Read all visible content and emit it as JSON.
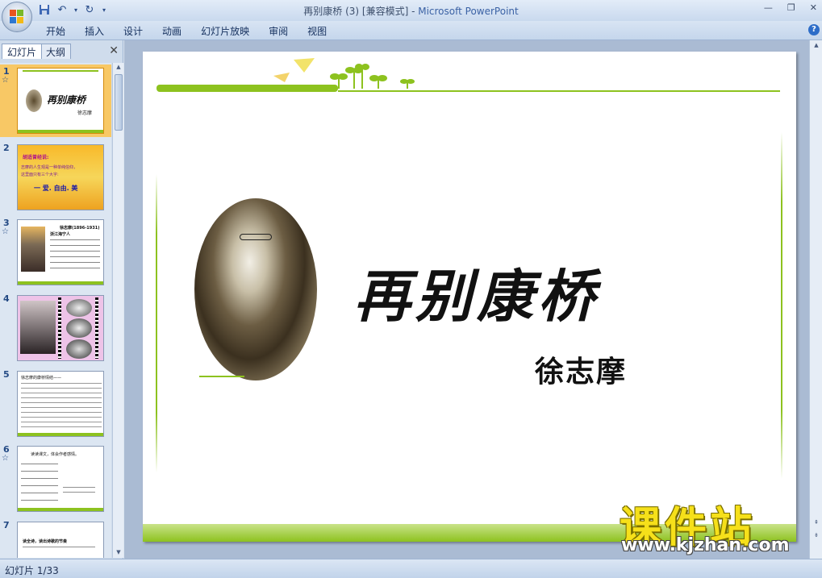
{
  "window": {
    "title_doc": "再别康桥 (3) [兼容模式] - ",
    "title_app": "Microsoft PowerPoint",
    "minimize": "—",
    "restore": "❐",
    "close": "✕"
  },
  "ribbon": {
    "tabs": [
      "开始",
      "插入",
      "设计",
      "动画",
      "幻灯片放映",
      "审阅",
      "视图"
    ],
    "help": "?"
  },
  "left_pane": {
    "tab_slides": "幻灯片",
    "tab_outline": "大纲",
    "close": "✕",
    "slides": [
      {
        "num": "1",
        "anim": "☆",
        "selected": true,
        "caption": "再别康桥",
        "sub": "徐志摩"
      },
      {
        "num": "2",
        "anim": "",
        "selected": false,
        "line1": "胡适曾经说:",
        "line2": "志摩的人生观是一种单纯信仰，",
        "line3": "这里面只有三个大字:",
        "line4": "一 爱. 自由. 美"
      },
      {
        "num": "3",
        "anim": "☆",
        "selected": false,
        "line1": "徐志摩(1896-1931)",
        "line2": "浙江海宁人"
      },
      {
        "num": "4",
        "anim": "",
        "selected": false
      },
      {
        "num": "5",
        "anim": "",
        "selected": false,
        "line1": "徐志摩的康桥情结——"
      },
      {
        "num": "6",
        "anim": "☆",
        "selected": false,
        "line1": "读读课文，体会作者感情。"
      },
      {
        "num": "7",
        "anim": "",
        "selected": false,
        "line1": "读全诗，读出诗歌的节奏"
      }
    ]
  },
  "slide": {
    "title": "再别康桥",
    "author": "徐志摩"
  },
  "status": {
    "text": "幻灯片 1/33"
  },
  "watermark": {
    "title": "课件站",
    "url": "www.kjzhan.com"
  },
  "colors": {
    "green": "#8dc21f",
    "green_dark": "#5c9b1b",
    "selected": "#f8c865"
  }
}
